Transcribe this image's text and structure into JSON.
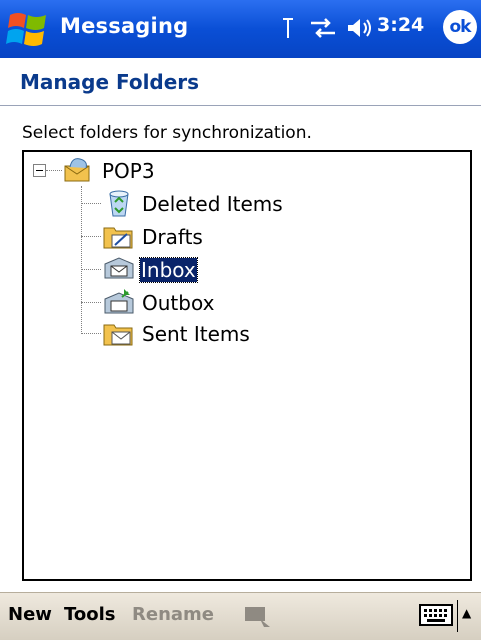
{
  "titlebar": {
    "app_title": "Messaging",
    "time": "3:24",
    "ok_label": "ok",
    "icons": [
      "windows-start-icon",
      "signal-antenna-icon",
      "connectivity-arrows-icon",
      "volume-speaker-icon"
    ]
  },
  "header": {
    "title": "Manage Folders"
  },
  "instruction": "Select folders for synchronization.",
  "tree": {
    "root": {
      "label": "POP3",
      "expanded": true,
      "icon": "mail-account-icon"
    },
    "children": [
      {
        "label": "Deleted Items",
        "icon": "recycle-bin-icon",
        "selected": false
      },
      {
        "label": "Drafts",
        "icon": "drafts-folder-icon",
        "selected": false
      },
      {
        "label": "Inbox",
        "icon": "inbox-icon",
        "selected": true
      },
      {
        "label": "Outbox",
        "icon": "outbox-icon",
        "selected": false
      },
      {
        "label": "Sent Items",
        "icon": "sent-items-folder-icon",
        "selected": false
      }
    ]
  },
  "bottombar": {
    "menus": [
      {
        "label": "New",
        "enabled": true
      },
      {
        "label": "Tools",
        "enabled": true
      },
      {
        "label": "Rename",
        "enabled": false
      }
    ],
    "icons": [
      "send-receive-icon",
      "keyboard-icon",
      "sip-arrow-icon"
    ]
  },
  "colors": {
    "titlebar": "#0a4fd6",
    "header_text": "#0a3a8c",
    "selection": "#0a246a",
    "bottombar": "#e3ddd1"
  }
}
